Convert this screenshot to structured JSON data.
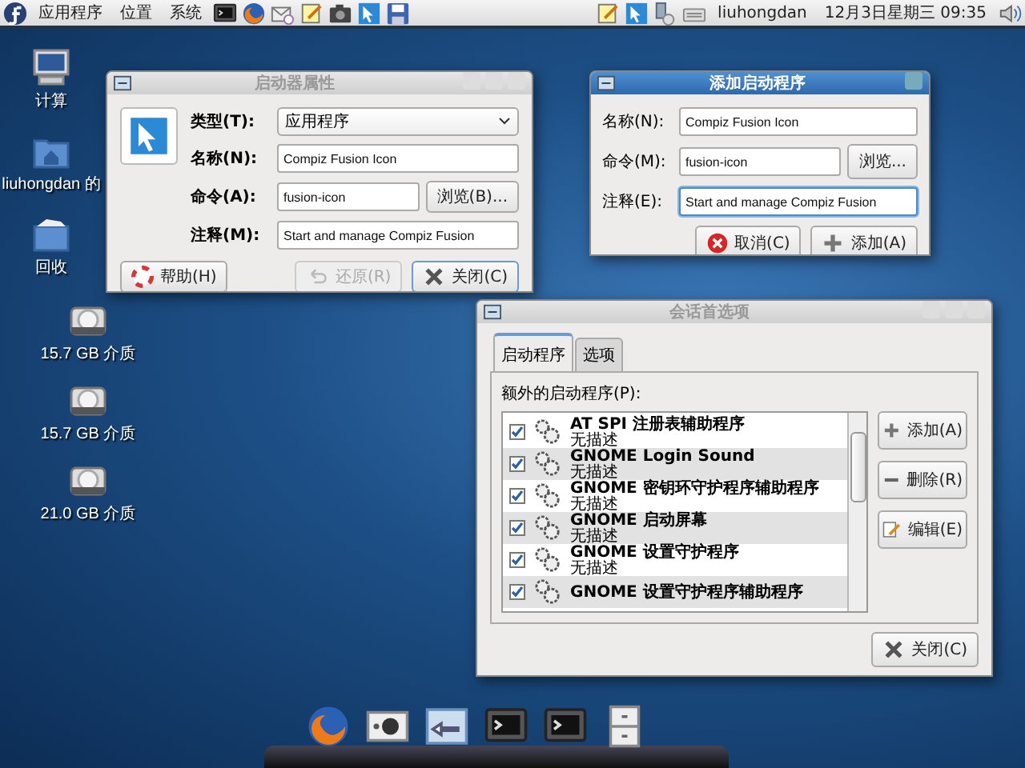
{
  "top_panel": {
    "menus": [
      "应用程序",
      "位置",
      "系统"
    ],
    "launchers": [
      {
        "kind": "terminal"
      },
      {
        "kind": "globe"
      },
      {
        "kind": "mail"
      },
      {
        "kind": "note"
      },
      {
        "kind": "camera"
      },
      {
        "kind": "pointer"
      },
      {
        "kind": "save"
      }
    ],
    "tray": [
      {
        "kind": "note"
      },
      {
        "kind": "pointer"
      },
      {
        "kind": "network"
      },
      {
        "kind": "keyboard"
      }
    ],
    "user": "liuhongdan",
    "clock": "12月3日星期三 09:35"
  },
  "desktop_icons": [
    {
      "kind": "computer",
      "label": "计算"
    },
    {
      "kind": "home",
      "label": "liuhongdan 的"
    },
    {
      "kind": "trash",
      "label": "回收"
    },
    {
      "kind": "drive",
      "label": "15.7 GB 介质"
    },
    {
      "kind": "drive",
      "label": "15.7 GB 介质"
    },
    {
      "kind": "drive",
      "label": "21.0 GB 介质"
    }
  ],
  "launcher_window": {
    "title": "启动器属性",
    "type_label": "类型(T):",
    "type_value": "应用程序",
    "fields": [
      {
        "label": "名称(N):",
        "value": "Compiz Fusion Icon"
      },
      {
        "label": "命令(A):",
        "value": "fusion-icon",
        "browse": "浏览(B)..."
      },
      {
        "label": "注释(M):",
        "value": "Start and manage Compiz Fusion"
      }
    ],
    "help_button": "帮助(H)",
    "revert_button": {
      "label": "还原(R)",
      "disabled": true
    },
    "close_button": "关闭(C)"
  },
  "add_window": {
    "title": "添加启动程序",
    "fields": [
      {
        "label": "名称(N):",
        "value": "Compiz Fusion Icon",
        "focused": false
      },
      {
        "label": "命令(M):",
        "value": "fusion-icon",
        "focused": false,
        "browse": "浏览..."
      },
      {
        "label": "注释(E):",
        "value": "Start and manage Compiz Fusion",
        "focused": true
      }
    ],
    "cancel_button": "取消(C)",
    "add_button": "添加(A)"
  },
  "session_window": {
    "title": "会话首选项",
    "tabs": [
      {
        "label": "启动程序",
        "selected": true
      },
      {
        "label": "选项",
        "selected": false
      }
    ],
    "list_label": "额外的启动程序(P):",
    "items": [
      {
        "checked": true,
        "name": "AT SPI 注册表辅助程序",
        "description": "无描述"
      },
      {
        "checked": true,
        "name": "GNOME Login Sound",
        "description": "无描述"
      },
      {
        "checked": true,
        "name": "GNOME 密钥环守护程序辅助程序",
        "description": "无描述"
      },
      {
        "checked": true,
        "name": "GNOME 启动屏幕",
        "description": "无描述"
      },
      {
        "checked": true,
        "name": "GNOME 设置守护程序",
        "description": "无描述"
      },
      {
        "checked": true,
        "name": "GNOME 设置守护程序辅助程序"
      }
    ],
    "add_button": "添加(A)",
    "remove_button": "删除(R)",
    "edit_button": "编辑(E)",
    "close_button": "关闭(C)"
  },
  "dock": [
    {
      "kind": "globe"
    },
    {
      "kind": "paw"
    },
    {
      "kind": "session"
    },
    {
      "kind": "terminal"
    },
    {
      "kind": "terminal"
    },
    {
      "kind": "cabinet"
    }
  ]
}
